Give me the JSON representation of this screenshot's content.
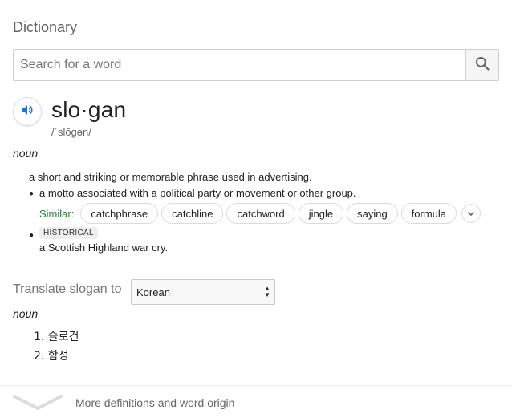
{
  "card": {
    "title": "Dictionary"
  },
  "search": {
    "placeholder": "Search for a word",
    "value": ""
  },
  "entry": {
    "word": "slo·gan",
    "phonetic": "/ˈslōɡən/",
    "part_of_speech": "noun",
    "definitions": [
      {
        "text": "a short and striking or memorable phrase used in advertising."
      },
      {
        "text": "a motto associated with a political party or movement or other group."
      },
      {
        "tag": "HISTORICAL",
        "text": "a Scottish Highland war cry."
      }
    ],
    "similar_label": "Similar:",
    "similar": [
      "catchphrase",
      "catchline",
      "catchword",
      "jingle",
      "saying",
      "formula"
    ]
  },
  "translate": {
    "label": "Translate slogan to",
    "language": "Korean",
    "part_of_speech": "noun",
    "items": [
      "1. 슬로건",
      "2. 함성"
    ]
  },
  "footer": {
    "more_label": "More definitions and word origin"
  },
  "colors": {
    "accent_blue": "#1a73e8",
    "similar_green": "#188038"
  },
  "icons": [
    "search-icon",
    "speaker-icon",
    "chevron-down-icon",
    "select-arrows-icon",
    "expand-chevron-icon"
  ]
}
